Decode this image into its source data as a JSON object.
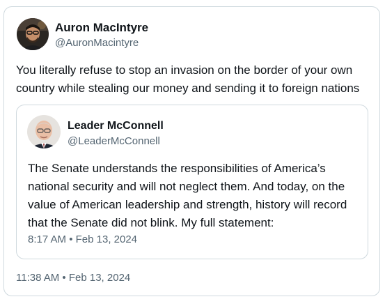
{
  "tweet": {
    "author": {
      "name": "Auron MacIntyre",
      "handle": "@AuronMacintyre"
    },
    "text": "You literally refuse to stop an invasion on the border of your own country while stealing our money and sending it to foreign nations",
    "timestamp": "11:38 AM • Feb 13, 2024"
  },
  "quoted_tweet": {
    "author": {
      "name": "Leader McConnell",
      "handle": "@LeaderMcConnell"
    },
    "text": "The Senate understands the responsibilities of America’s national security and will not neglect them. And today, on the value of American leadership and strength, history will record that the Senate did not blink. My full statement:",
    "timestamp": "8:17 AM • Feb 13, 2024"
  },
  "colors": {
    "text_primary": "#0f1419",
    "text_secondary": "#536471",
    "border": "#cfd9de"
  }
}
